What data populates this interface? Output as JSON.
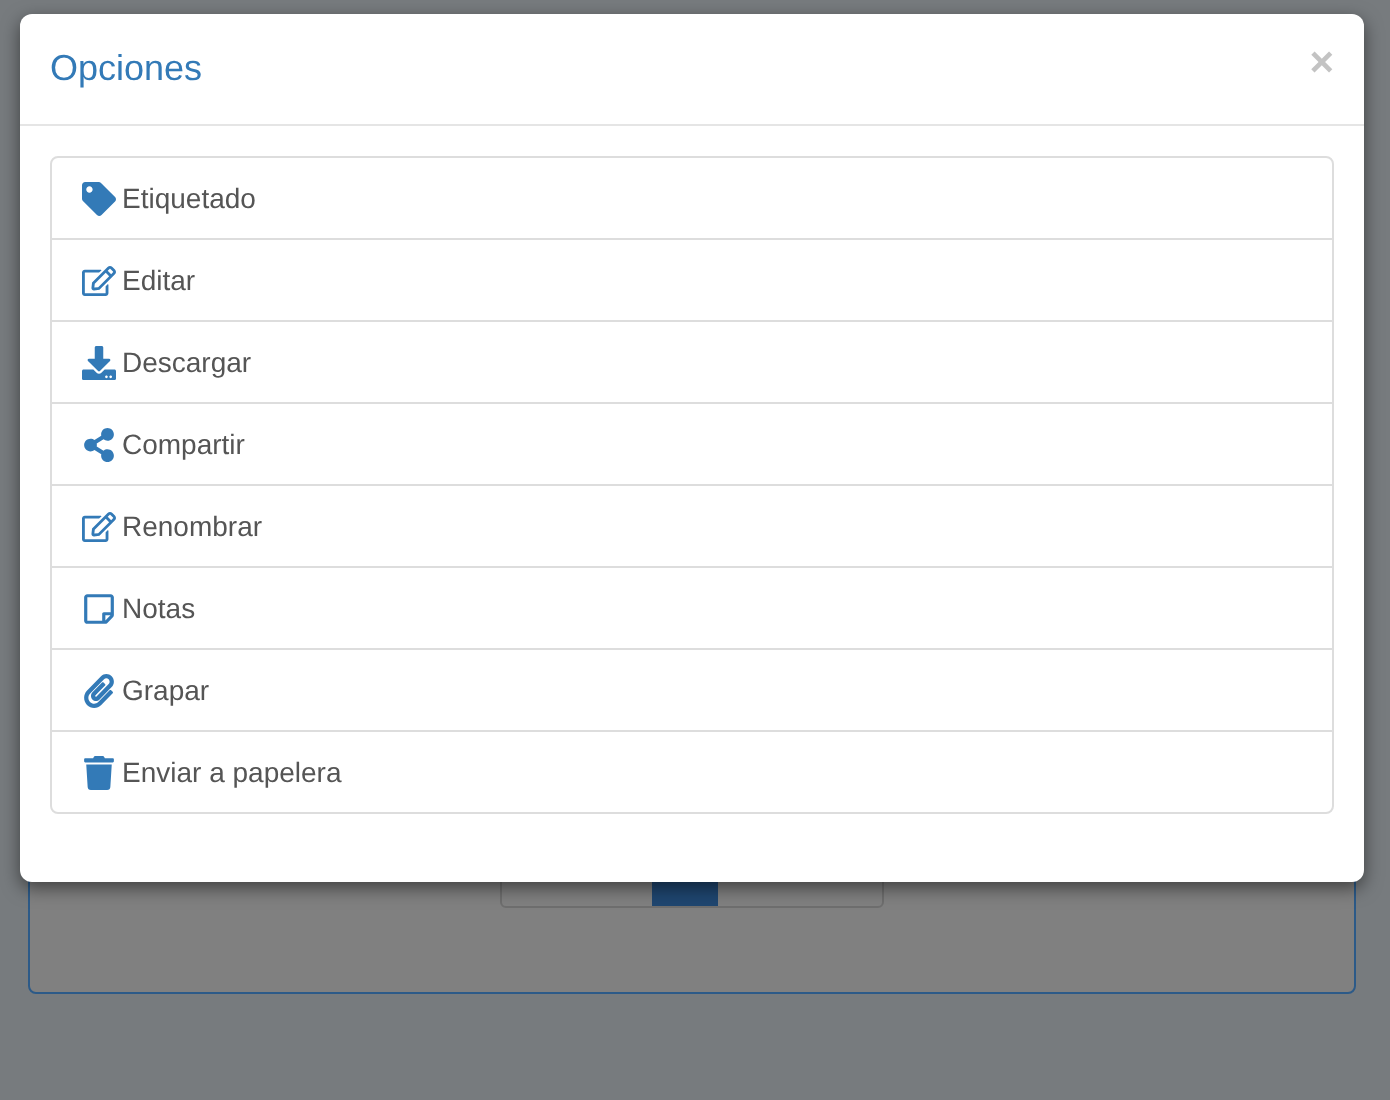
{
  "dialog": {
    "title": "Opciones",
    "close": "×"
  },
  "options": [
    {
      "label": "Etiquetado"
    },
    {
      "label": "Editar"
    },
    {
      "label": "Descargar"
    },
    {
      "label": "Compartir"
    },
    {
      "label": "Renombrar"
    },
    {
      "label": "Notas"
    },
    {
      "label": "Grapar"
    },
    {
      "label": "Enviar a papelera"
    }
  ]
}
